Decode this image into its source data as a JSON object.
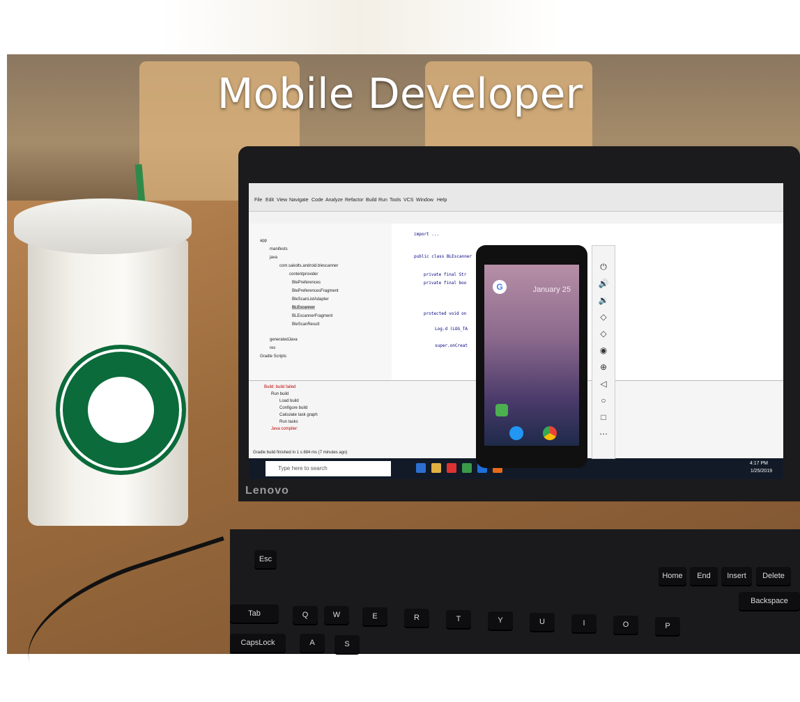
{
  "title": "Mobile Developer",
  "ide": {
    "menu": [
      "File",
      "Edit",
      "View",
      "Navigate",
      "Code",
      "Analyze",
      "Refactor",
      "Build",
      "Run",
      "Tools",
      "VCS",
      "Window",
      "Help"
    ],
    "tree": [
      "app",
      "manifests",
      "java",
      "com.sakolts.android.blescanner",
      "contentprovider",
      "BlePreferences",
      "BlePreferencesFragment",
      "BleScanListAdapter",
      "BLEscanner",
      "BLEscannerFragment",
      "BleScanResult",
      "generatedJava",
      "res",
      "Gradle Scripts"
    ],
    "code": [
      "import ...",
      "public class BLEscanner",
      "private final Str",
      "private final boo",
      "protected void on",
      "Log.d (LOG_TA",
      "super.onCreat"
    ],
    "build_lines": [
      "Build: build failed",
      "Run build",
      "Load build",
      "Configure build",
      "Calculate task graph",
      "Run tasks",
      "Java compiler:"
    ],
    "status": "Gradle build finished in 1 s 884 ms (7 minutes ago)"
  },
  "taskbar": {
    "search_placeholder": "Type here to search",
    "time": "4:17 PM",
    "date": "1/25/2019"
  },
  "emulator": {
    "date": "January 25",
    "google_glyph": "G"
  },
  "brand": "Lenovo",
  "keyboard": [
    "Esc",
    "Home",
    "End",
    "Insert",
    "Delete",
    "Q",
    "W",
    "E",
    "R",
    "T",
    "Y",
    "U",
    "I",
    "O",
    "P",
    "Tab",
    "Backspace",
    "CapsLock",
    "A",
    "S"
  ]
}
